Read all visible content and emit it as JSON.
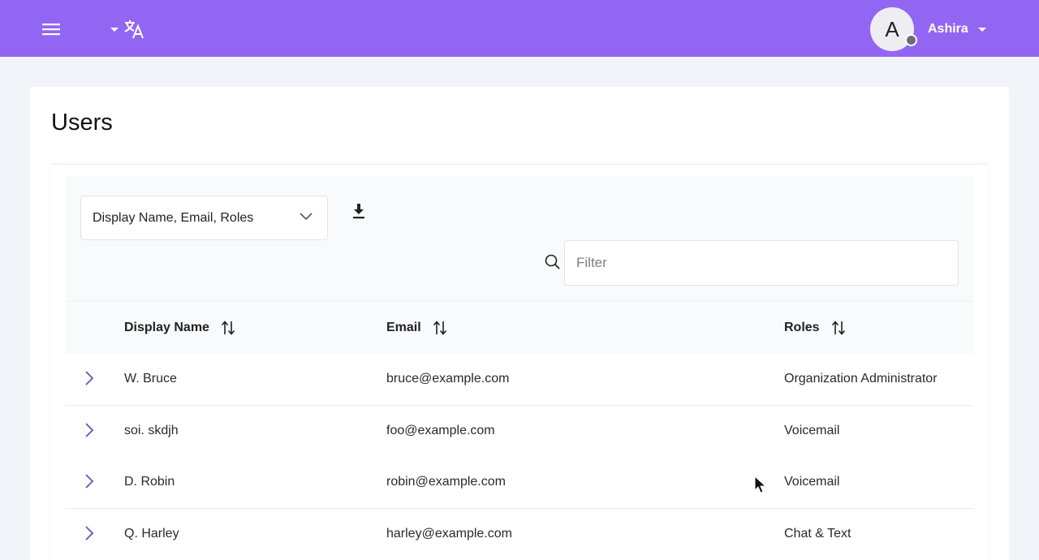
{
  "header": {
    "user_initial": "A",
    "user_name": "Ashira",
    "brand_color": "#9266f3"
  },
  "icons": [
    "hamburger-menu-icon",
    "language-icon",
    "download-icon",
    "search-icon",
    "sort-icon",
    "chevron-right-icon",
    "chevron-down-icon"
  ],
  "page": {
    "title": "Users"
  },
  "toolbar": {
    "columns_select_value": "Display Name, Email, Roles",
    "filter_placeholder": "Filter"
  },
  "table": {
    "headers": {
      "display_name": "Display Name",
      "email": "Email",
      "roles": "Roles"
    },
    "rows": [
      {
        "name": "W. Bruce",
        "email": "bruce@example.com",
        "roles": "Organization Administrator"
      },
      {
        "name": "soi. skdjh",
        "email": "foo@example.com",
        "roles": "Voicemail"
      },
      {
        "name": "D. Robin",
        "email": "robin@example.com",
        "roles": "Voicemail"
      },
      {
        "name": "Q. Harley",
        "email": "harley@example.com",
        "roles": "Chat & Text"
      }
    ]
  }
}
